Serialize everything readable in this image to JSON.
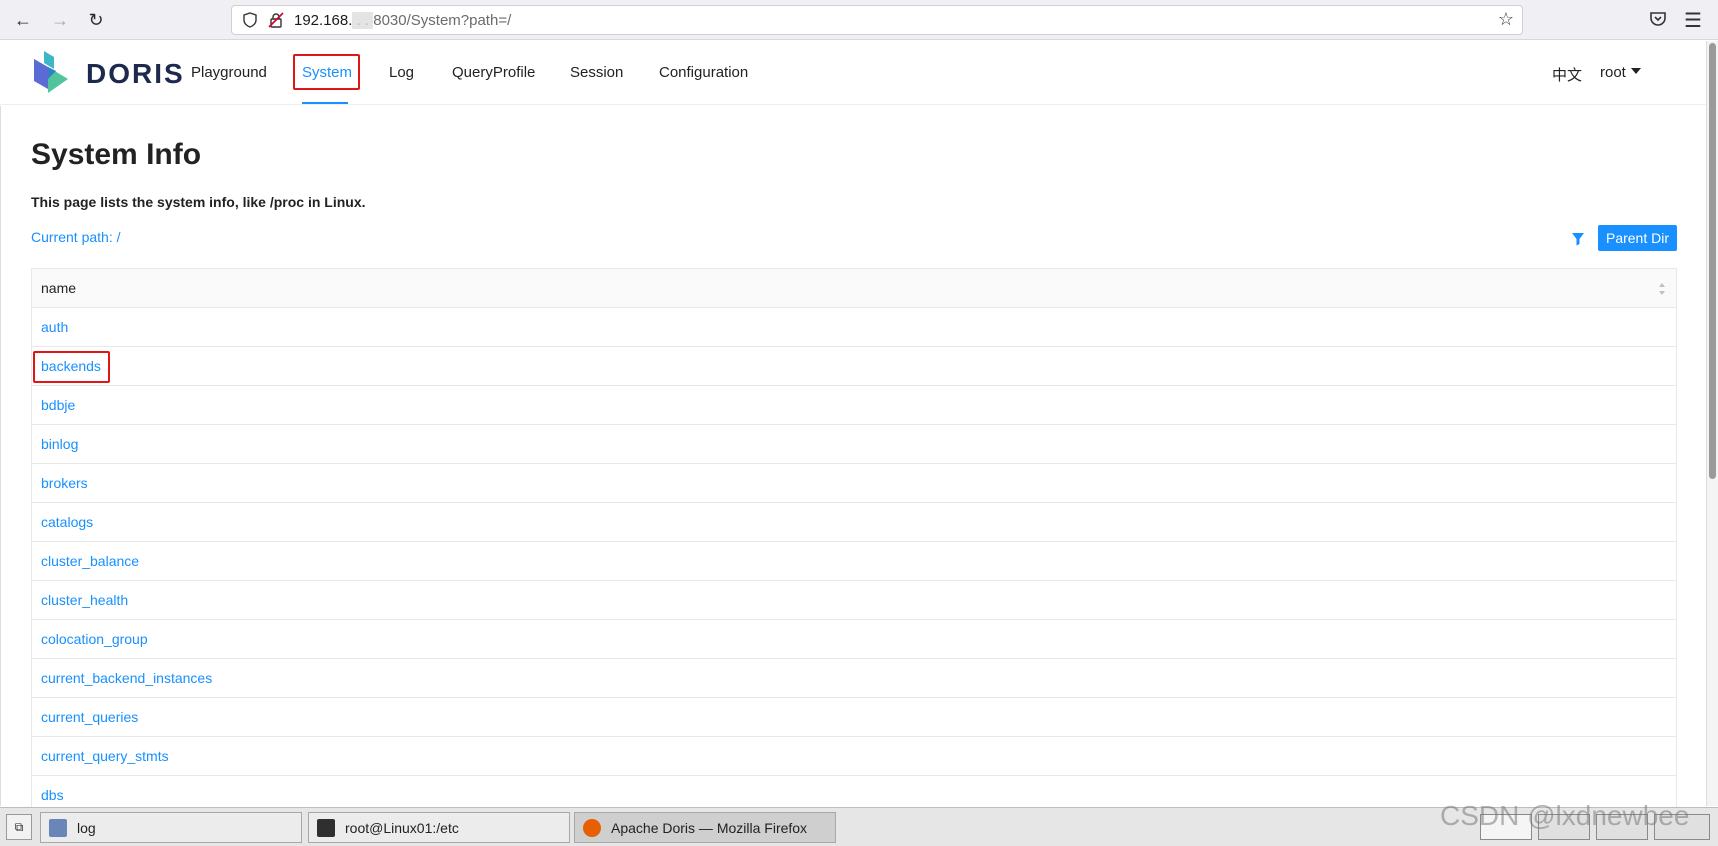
{
  "browser": {
    "url_host": "192.168.",
    "url_masked": "  .  .  ",
    "url_rest": "8030/System?path=/"
  },
  "app": {
    "brand": "DORIS",
    "nav": [
      {
        "label": "Playground"
      },
      {
        "label": "System"
      },
      {
        "label": "Log"
      },
      {
        "label": "QueryProfile"
      },
      {
        "label": "Session"
      },
      {
        "label": "Configuration"
      }
    ],
    "active_nav": "System",
    "language": "中文",
    "user": "root",
    "accent_color": "#1890ff",
    "highlight_color": "#e01515"
  },
  "page": {
    "title": "System Info",
    "description": "This page lists the system info, like /proc in Linux.",
    "current_path": "Current path: /",
    "parent_button": "Parent Dir",
    "table_header": "name",
    "rows": [
      "auth",
      "backends",
      "bdbje",
      "binlog",
      "brokers",
      "catalogs",
      "cluster_balance",
      "cluster_health",
      "colocation_group",
      "current_backend_instances",
      "current_queries",
      "current_query_stmts",
      "dbs"
    ]
  },
  "taskbar": {
    "tasks": [
      {
        "label": "log"
      },
      {
        "label": "root@Linux01:/etc"
      },
      {
        "label": "Apache Doris — Mozilla Firefox"
      }
    ]
  },
  "watermark": "CSDN @lxdnewbee"
}
